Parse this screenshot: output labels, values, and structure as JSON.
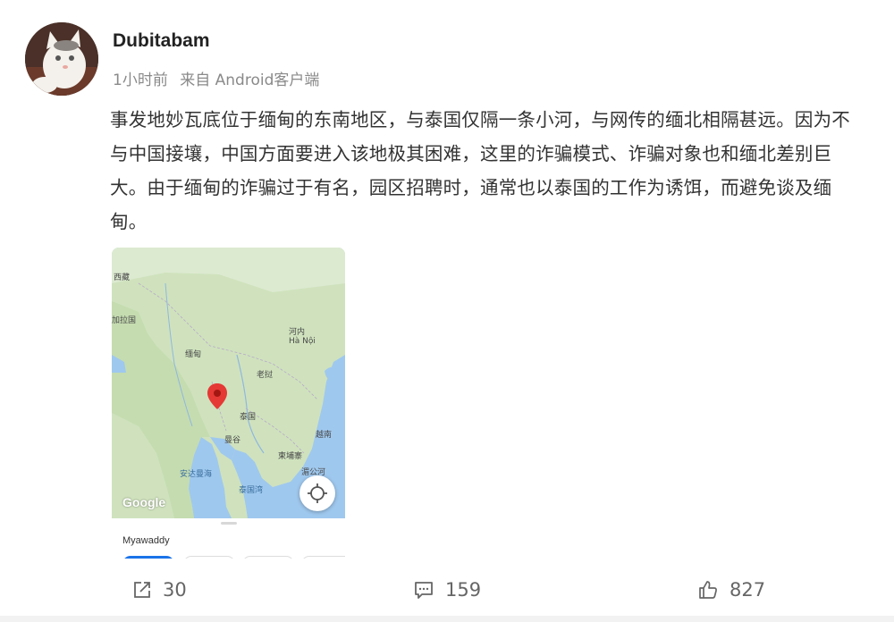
{
  "post": {
    "username": "Dubitabam",
    "time": "1小时前",
    "source": "来自 Android客户端",
    "content": "事发地妙瓦底位于缅甸的东南地区，与泰国仅隔一条小河，与网传的缅北相隔甚远。因为不与中国接壤，中国方面要进入该地极其困难，这里的诈骗模式、诈骗对象也和缅北差别巨大。由于缅甸的诈骗过于有名，园区招聘时，通常也以泰国的工作为诱饵，而避免谈及缅甸。"
  },
  "map": {
    "labels": {
      "tibet": "西藏",
      "bangladesh": "加拉国",
      "myanmar": "缅甸",
      "hanoi": "河内\nHà Nội",
      "laos": "老挝",
      "thailand": "泰国",
      "bangkok": "曼谷",
      "vietnam": "越南",
      "cambodia": "柬埔寨",
      "andaman": "安达曼海",
      "gulf": "泰国湾",
      "river": "湄公河"
    },
    "google_text": "Google",
    "place_name": "Myawaddy",
    "locate_icon": "locate-icon",
    "pin_icon": "location-pin-icon"
  },
  "actions": {
    "share_count": "30",
    "comment_count": "159",
    "like_count": "827"
  },
  "colors": {
    "land": "#d7e7c8",
    "sea": "#9fc8ee",
    "pin": "#e53935",
    "chip_primary": "#1a73e8"
  }
}
